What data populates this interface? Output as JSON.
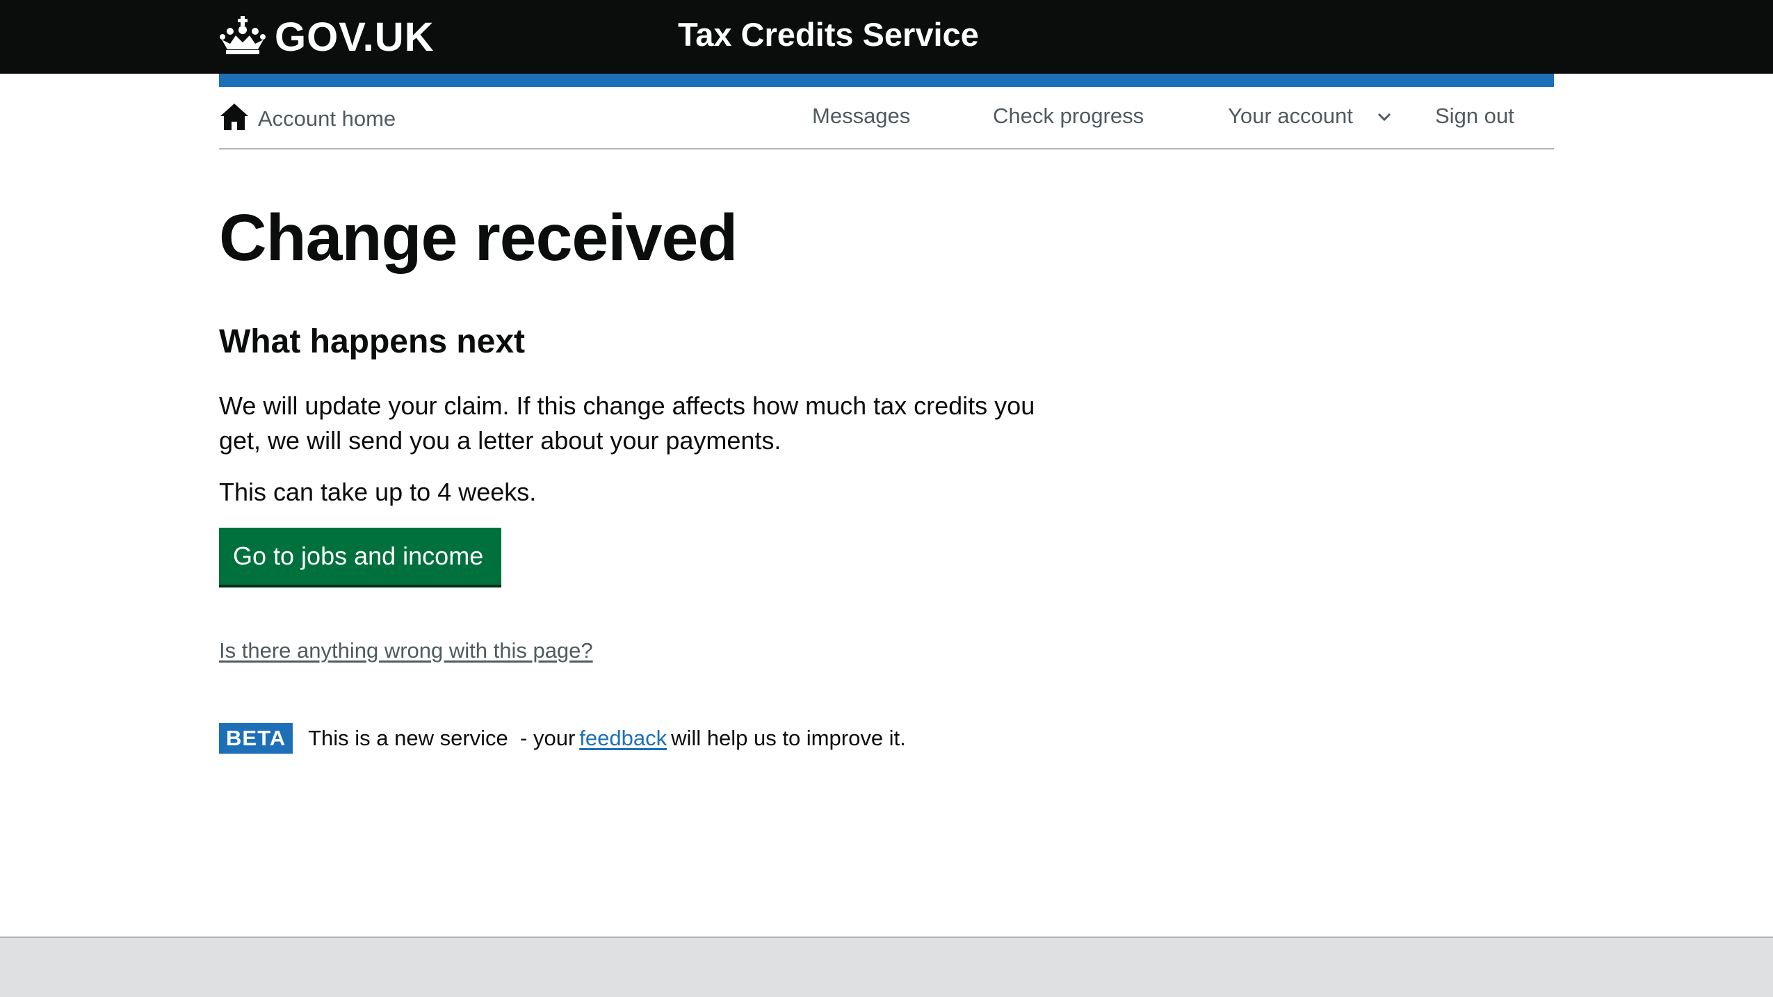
{
  "header": {
    "logo_text": "GOV.UK",
    "logo_icon": "crown-icon",
    "service_name": "Tax Credits Service",
    "background_color": "#0b0c0c",
    "accent_bar_color": "#1d70b8"
  },
  "nav": {
    "home_icon": "home-icon",
    "home_label": "Account home",
    "messages_label": "Messages",
    "check_progress_label": "Check progress",
    "your_account_label": "Your account",
    "your_account_icon": "chevron-down-icon",
    "sign_out_label": "Sign out"
  },
  "main": {
    "title": "Change received",
    "subheading": "What happens next",
    "paragraph_1": "We will update your claim. If this change affects how much tax credits you get, we will send you a letter about your payments.",
    "paragraph_2": "This can take up to 4 weeks.",
    "primary_button_label": "Go to jobs and income",
    "primary_button_color": "#00703c",
    "report_link": "Is there anything wrong with this page?"
  },
  "beta_banner": {
    "tag": "BETA",
    "text_before": "This is a new service  - your",
    "link_text": "feedback",
    "text_after": "will help us to improve it."
  }
}
